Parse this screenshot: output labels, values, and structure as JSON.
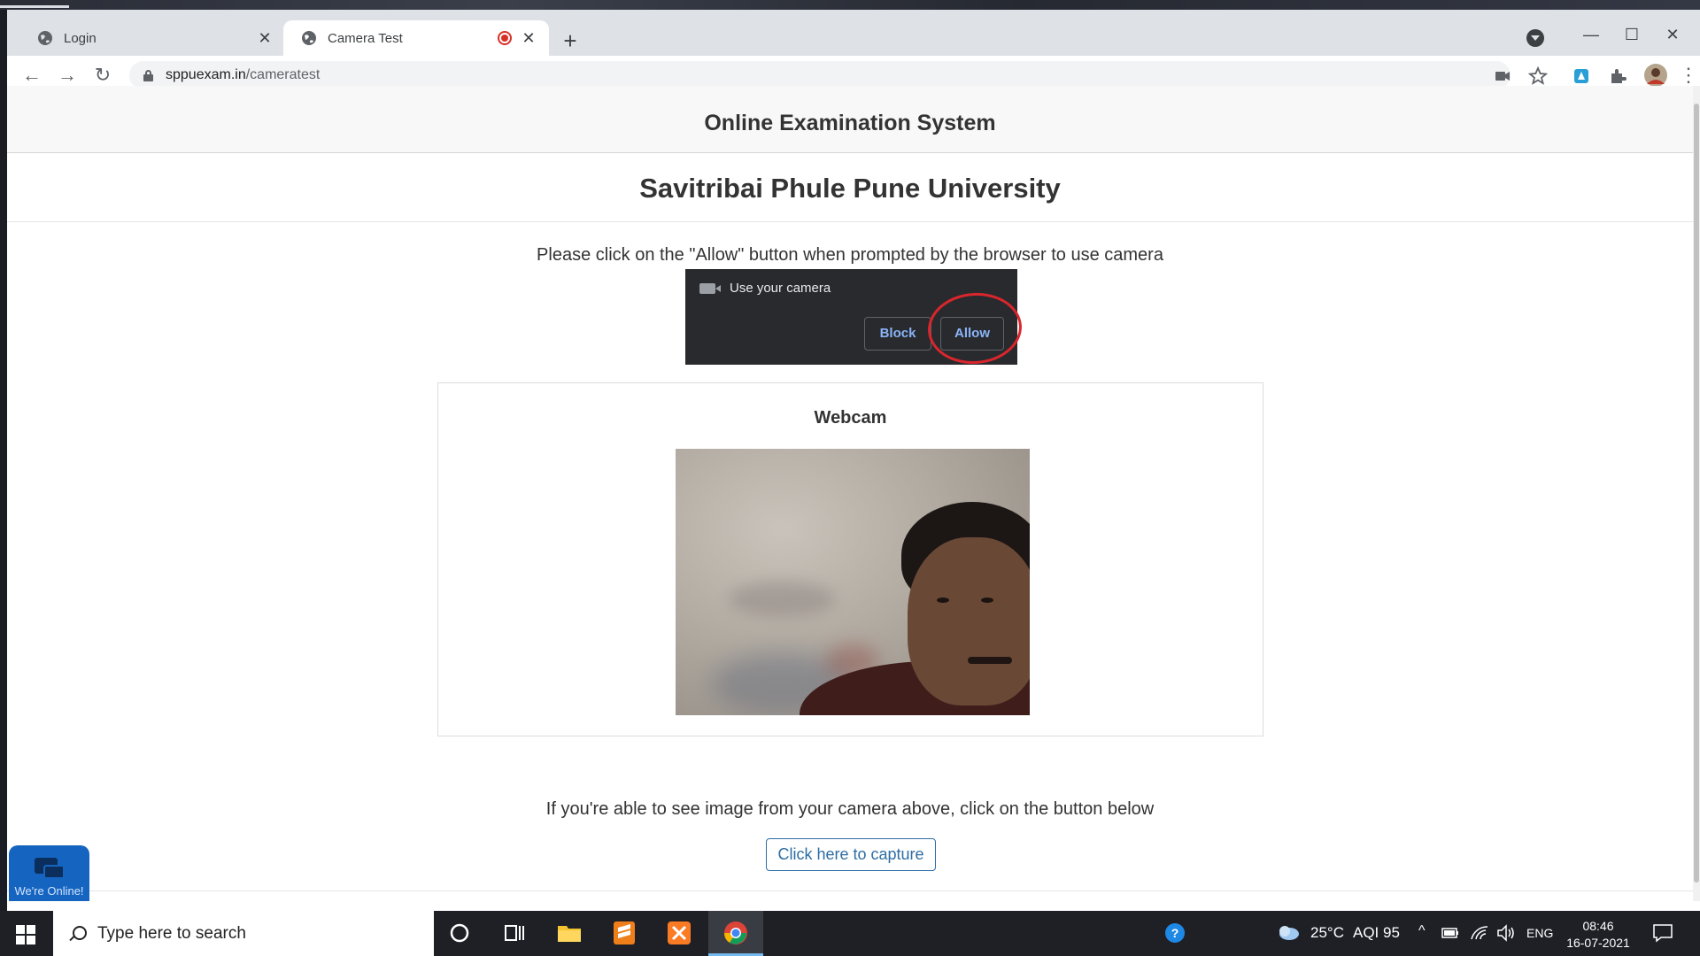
{
  "browser": {
    "tabs": [
      {
        "title": "Login"
      },
      {
        "title": "Camera Test"
      }
    ],
    "url_host": "sppuexam.in",
    "url_path": "/cameratest"
  },
  "page": {
    "header_title": "Online Examination System",
    "university": "Savitribai Phule Pune University",
    "instruction": "Please click on the \"Allow\" button when prompted by the browser to use camera",
    "permission_prompt": {
      "title": "Use your camera",
      "block_label": "Block",
      "allow_label": "Allow"
    },
    "webcam_title": "Webcam",
    "capture_instruction": "If you're able to see image from your camera above, click on the button below",
    "capture_button": "Click here to capture",
    "chat_widget_text": "We're Online!"
  },
  "taskbar": {
    "search_placeholder": "Type here to search",
    "weather": "25°C",
    "aqi": "AQI 95",
    "language": "ENG",
    "time": "08:46",
    "date": "16-07-2021"
  },
  "colors": {
    "accent": "#2e6da4",
    "recording": "#d93025",
    "annotation": "#d9262d"
  }
}
